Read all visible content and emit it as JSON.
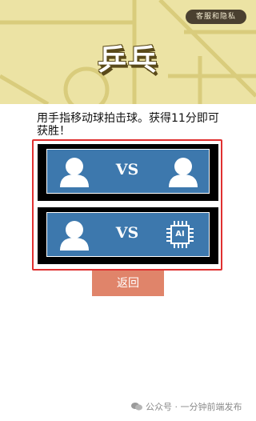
{
  "header": {
    "privacy_button": "客服和隐私",
    "title": "乒乓"
  },
  "instructions": "用手指移动球拍击球。获得11分即可获胜！",
  "modes": [
    {
      "left_player": "person-icon",
      "vs": "VS",
      "right_player": "person-icon"
    },
    {
      "left_player": "person-icon",
      "vs": "VS",
      "right_player": "ai-chip-icon",
      "ai_label": "AI"
    }
  ],
  "back_button": "返回",
  "watermark": "公众号 · 一分钟前端发布",
  "colors": {
    "hero_bg": "#ece3a4",
    "card_blue": "#3d78ad",
    "highlight_red": "#e03030",
    "back_button": "#e0846a"
  }
}
